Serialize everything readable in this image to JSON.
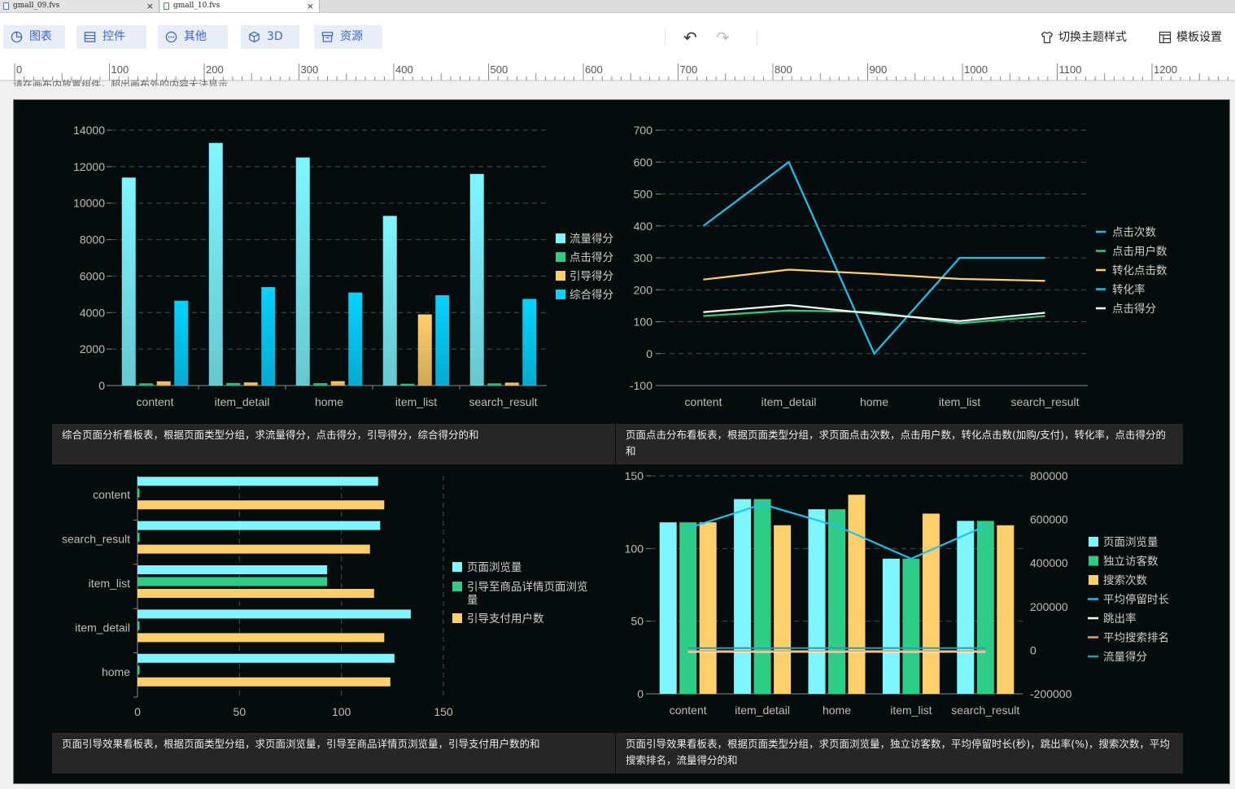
{
  "tabs": [
    {
      "label": "gmall_09.fvs",
      "close": "×"
    },
    {
      "label": "gmall_10.fvs",
      "close": "×"
    }
  ],
  "toolbar": {
    "buttons": [
      {
        "label": "图表",
        "icon": "pie-chart-icon"
      },
      {
        "label": "控件",
        "icon": "widget-icon"
      },
      {
        "label": "其他",
        "icon": "more-icon"
      },
      {
        "label": "3D",
        "icon": "cube-icon"
      },
      {
        "label": "资源",
        "icon": "archive-icon"
      }
    ],
    "undo": "↶",
    "redo": "↷",
    "theme": "切换主题样式",
    "template": "模板设置"
  },
  "ruler": {
    "labels": [
      "0",
      "100",
      "200",
      "300",
      "400",
      "500",
      "600",
      "700",
      "800",
      "900",
      "1000",
      "1100",
      "1200"
    ]
  },
  "hint": "请在画布内放置组件，超出画布外的内容无法显示",
  "captions": [
    "综合页面分析看板表，根据页面类型分组，求流量得分，点击得分，引导得分，综合得分的和",
    "页面点击分布看板表，根据页面类型分组，求页面点击次数，点击用户数，转化点击数(加购/支付)，转化率，点击得分的和",
    "页面引导效果看板表，根据页面类型分组，求页面浏览量，引导至商品详情页浏览量，引导支付用户数的和",
    "页面引导效果看板表，根据页面类型分组，求页面浏览量，独立访客数，平均停留时长(秒)，跳出率(%)，搜索次数，平均搜索排名，流量得分的和"
  ],
  "chart_data": [
    {
      "type": "bar",
      "categories": [
        "content",
        "item_detail",
        "home",
        "item_list",
        "search_result"
      ],
      "ylim": [
        0,
        14000
      ],
      "yticks": [
        0,
        2000,
        4000,
        6000,
        8000,
        10000,
        12000,
        14000
      ],
      "legend_position": "right",
      "grid": true,
      "series": [
        {
          "name": "流量得分",
          "color": "#7ff6ff",
          "values": [
            11400,
            13300,
            12500,
            9300,
            11600
          ]
        },
        {
          "name": "点击得分",
          "color": "#2ecc87",
          "values": [
            120,
            140,
            130,
            100,
            120
          ]
        },
        {
          "name": "引导得分",
          "color": "#ffcf6b",
          "values": [
            230,
            170,
            240,
            3900,
            160
          ]
        },
        {
          "name": "综合得分",
          "color": "#05d2ff",
          "values": [
            4650,
            5400,
            5100,
            4950,
            4750
          ]
        }
      ]
    },
    {
      "type": "line",
      "categories": [
        "content",
        "item_detail",
        "home",
        "item_list",
        "search_result"
      ],
      "ylim": [
        -100,
        700
      ],
      "yticks": [
        -100,
        0,
        100,
        200,
        300,
        400,
        500,
        600,
        700
      ],
      "legend_position": "right",
      "grid": true,
      "series": [
        {
          "name": "点击次数",
          "color": "#1ec2ef",
          "values": [
            400,
            600,
            0,
            300,
            300
          ]
        },
        {
          "name": "点击用户数",
          "color": "#2ecc87",
          "values": [
            118,
            135,
            130,
            95,
            118
          ]
        },
        {
          "name": "转化点击数",
          "color": "#ffcf6b",
          "values": [
            232,
            263,
            250,
            234,
            228
          ]
        },
        {
          "name": "转化率",
          "color": "#1ec2ef",
          "values": []
        },
        {
          "name": "点击得分",
          "color": "#ffffff",
          "values": [
            130,
            152,
            125,
            102,
            128
          ]
        }
      ]
    },
    {
      "type": "bar",
      "orientation": "horizontal",
      "categories": [
        "home",
        "item_detail",
        "item_list",
        "search_result",
        "content"
      ],
      "xlim": [
        0,
        150
      ],
      "xticks": [
        0,
        50,
        100,
        150
      ],
      "legend_position": "right",
      "series": [
        {
          "name": "页面浏览量",
          "color": "#7ff6ff",
          "values": [
            126,
            134,
            93,
            119,
            118
          ]
        },
        {
          "name": "引导至商品详情页面浏览量",
          "color": "#2ecc87",
          "values": [
            1,
            1,
            93,
            1,
            1
          ]
        },
        {
          "name": "引导支付用户数",
          "color": "#ffcf6b",
          "values": [
            124,
            121,
            116,
            114,
            121
          ]
        }
      ]
    },
    {
      "type": "bar",
      "categories": [
        "content",
        "item_detail",
        "home",
        "item_list",
        "search_result"
      ],
      "ylim": [
        0,
        150
      ],
      "yticks": [
        0,
        50,
        100,
        150
      ],
      "y2lim": [
        -200000,
        800000
      ],
      "y2ticks": [
        -200000,
        0,
        200000,
        400000,
        600000,
        800000
      ],
      "legend_position": "right",
      "grid": true,
      "series": [
        {
          "name": "页面浏览量",
          "color": "#7ff6ff",
          "type": "bar",
          "values": [
            118,
            134,
            127,
            93,
            119
          ]
        },
        {
          "name": "独立访客数",
          "color": "#2ecc87",
          "type": "bar",
          "values": [
            118,
            134,
            127,
            93,
            119
          ]
        },
        {
          "name": "搜索次数",
          "color": "#ffcf6b",
          "type": "bar",
          "values": [
            118,
            116,
            137,
            124,
            116
          ]
        },
        {
          "name": "平均停留时长",
          "color": "#1ec2ef",
          "type": "line",
          "values": [
            560000,
            670000,
            570000,
            420000,
            570000
          ]
        },
        {
          "name": "跳出率",
          "color": "#ffffff",
          "type": "line",
          "values": [
            0,
            0,
            0,
            0,
            0
          ]
        },
        {
          "name": "平均搜索排名",
          "color": "#f0a060",
          "type": "line",
          "values": [
            5,
            5,
            5,
            5,
            5
          ]
        },
        {
          "name": "流量得分",
          "color": "#1ba3b8",
          "type": "line",
          "values": [
            10000,
            10000,
            10000,
            10000,
            10000
          ]
        }
      ]
    }
  ]
}
